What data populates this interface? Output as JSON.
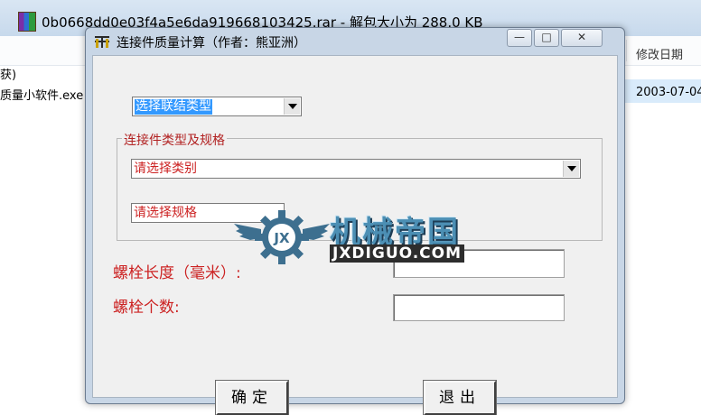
{
  "background_window": {
    "title": "0b0668dd0e03f4a5e6da919668103425.rar - 解包大小为 288.0 KB",
    "column_modified": "修改日期",
    "row1_name": "获)",
    "row2_name": "质量小软件.exe",
    "row2_date": "2003-07-04"
  },
  "dialog": {
    "title": "连接件质量计算（作者：熊亚洲）",
    "window_buttons": {
      "minimize": "—",
      "maximize": "□",
      "close": "✕"
    },
    "connection_type": {
      "value": "选择联结类型"
    },
    "group_title": "连接件类型及规格",
    "category": {
      "value": "请选择类别"
    },
    "spec": {
      "value": "请选择规格"
    },
    "bolt_length_label": "螺栓长度（毫米）:",
    "bolt_length_value": "",
    "bolt_count_label": "螺栓个数:",
    "bolt_count_value": "",
    "ok_button": "确定",
    "exit_button": "退出"
  },
  "watermark": {
    "logo_letters": "JX",
    "text_cn": "机械帝国",
    "text_en": "JXDIGUO.COM"
  },
  "colors": {
    "label_red": "#cc2222",
    "selection_blue": "#3399ff",
    "dialog_frame": "#c8d6e6"
  }
}
